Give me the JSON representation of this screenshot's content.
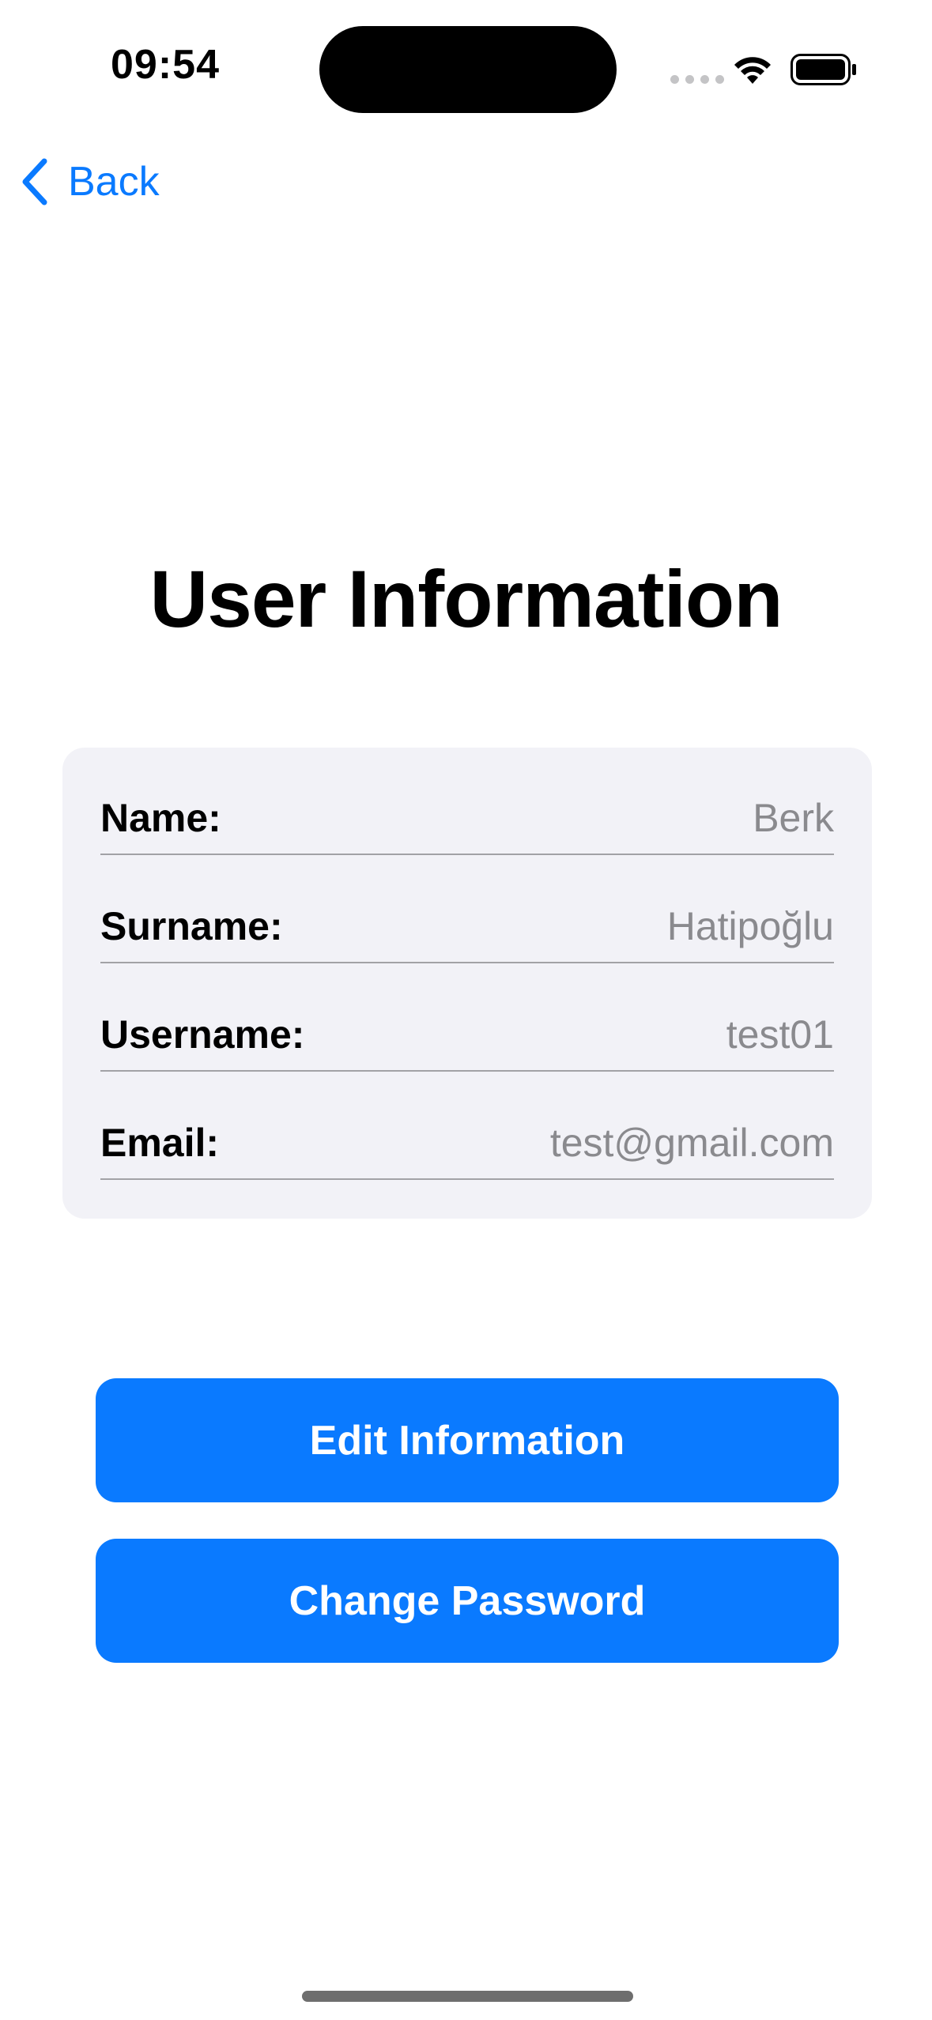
{
  "status_bar": {
    "time": "09:54",
    "icons": [
      "signal-dots-icon",
      "wifi-icon",
      "battery-icon"
    ]
  },
  "nav": {
    "back_label": "Back",
    "back_icon": "chevron-left-icon"
  },
  "page": {
    "title": "User Information"
  },
  "user_info": {
    "rows": [
      {
        "label": "Name:",
        "value": "Berk"
      },
      {
        "label": "Surname:",
        "value": "Hatipoğlu"
      },
      {
        "label": "Username:",
        "value": "test01"
      },
      {
        "label": "Email:",
        "value": "test@gmail.com"
      }
    ]
  },
  "actions": {
    "edit_label": "Edit Information",
    "change_password_label": "Change Password"
  },
  "colors": {
    "accent": "#0A7AFF",
    "card_background": "#F2F2F7",
    "value_text": "#8A8A8E"
  }
}
